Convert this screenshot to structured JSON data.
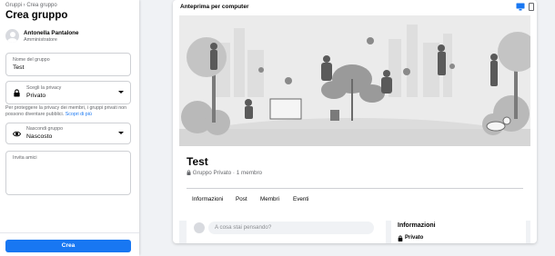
{
  "breadcrumb": "Gruppi › Crea gruppo",
  "page_title": "Crea gruppo",
  "admin": {
    "name": "Antonella Pantalone",
    "role": "Amministratore"
  },
  "group_name_field": {
    "label": "Nome del gruppo",
    "value": "Test"
  },
  "privacy_field": {
    "label": "Scegli la privacy",
    "value": "Privato"
  },
  "privacy_note": "Per proteggere la privacy dei membri, i gruppi privati non possono diventare pubblici.",
  "privacy_note_link": "Scopri di più",
  "hide_field": {
    "label": "Nascondi gruppo",
    "value": "Nascosto"
  },
  "invite_field": {
    "label": "Invita amici"
  },
  "create_button": "Crea",
  "preview": {
    "title": "Anteprima per computer",
    "group_name": "Test",
    "group_meta": "Gruppo Privato · 1 membro",
    "tabs": [
      "Informazioni",
      "Post",
      "Membri",
      "Eventi"
    ],
    "post_placeholder": "A cosa stai pensando?",
    "info_header": "Informazioni",
    "info_privacy": "Privato"
  },
  "colors": {
    "accent": "#1877f2",
    "muted": "#65676b"
  }
}
